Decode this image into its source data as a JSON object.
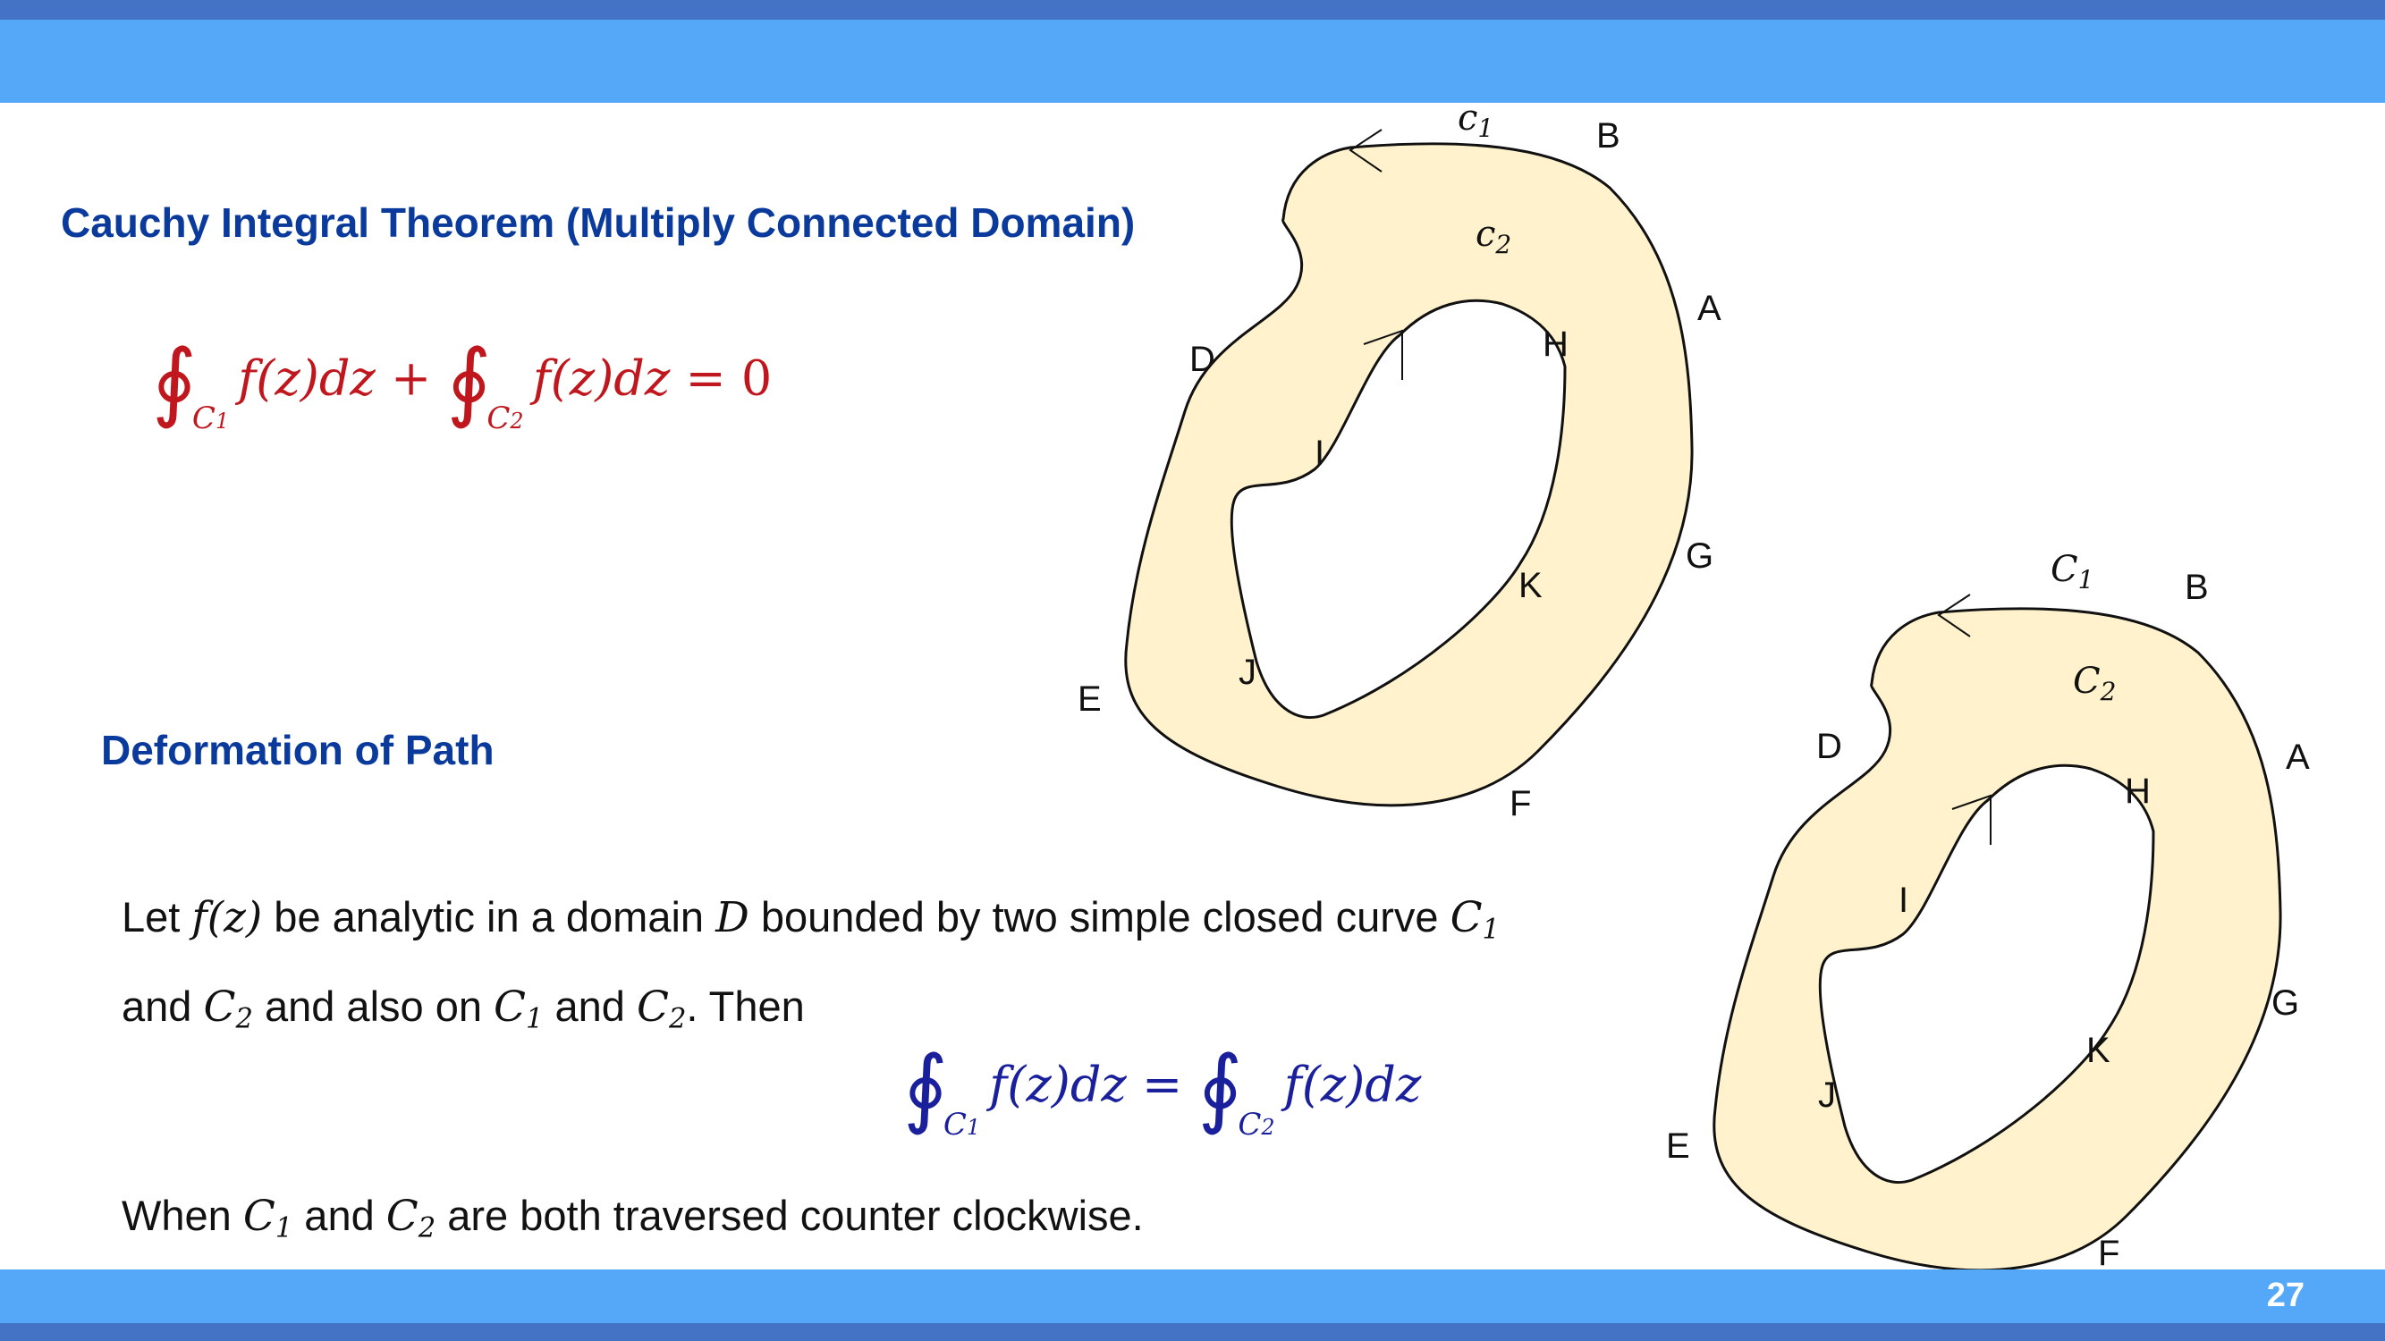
{
  "slide": {
    "page_number": "27"
  },
  "section1": {
    "heading": "Cauchy Integral Theorem (Multiply Connected Domain)",
    "equation": {
      "term1_limit": "C1",
      "term1_body": "f(z)dz",
      "plus": "+",
      "term2_limit": "C2",
      "term2_body": "f(z)dz",
      "rhs": "= 0"
    }
  },
  "section2": {
    "heading": "Deformation of Path",
    "line1": {
      "t1": "Let ",
      "fz": "f(z)",
      "t2": " be analytic in a domain ",
      "D": "D",
      "t3": " bounded by two simple closed curve ",
      "C": "C",
      "sub": "1"
    },
    "line2": {
      "t1": "and ",
      "C2": "C",
      "sub2": "2",
      "t2": " and also on ",
      "C1": "C",
      "sub1": "1",
      "t3": " and ",
      "C2b": "C",
      "sub2b": "2",
      "t4": ". Then"
    },
    "equation": {
      "lhs_limit": "C1",
      "lhs_body": "f(z)dz",
      "equals": "=",
      "rhs_limit": "C2",
      "rhs_body": "f(z)dz"
    },
    "line3": {
      "t1": "When ",
      "C1": "C",
      "sub1": "1",
      "t2": " and ",
      "C2": "C",
      "sub2": "2",
      "t3": " are both traversed counter clockwise."
    }
  },
  "diagram_top": {
    "outer_curve_label": "c1",
    "inner_curve_label": "c2",
    "points": [
      "B",
      "A",
      "G",
      "F",
      "E",
      "D",
      "H",
      "I",
      "J",
      "K"
    ]
  },
  "diagram_bottom": {
    "outer_curve_label": "C1",
    "inner_curve_label": "C2",
    "points": [
      "B",
      "A",
      "G",
      "F",
      "E",
      "D",
      "H",
      "I",
      "J",
      "K"
    ]
  },
  "colors": {
    "top_bar": "#55a8f8",
    "bar_edge": "#4472c4",
    "heading": "#0a3a9c",
    "eq_red": "#c0171e",
    "eq_blue": "#1a1f9c",
    "region_fill": "#fff2cc"
  }
}
